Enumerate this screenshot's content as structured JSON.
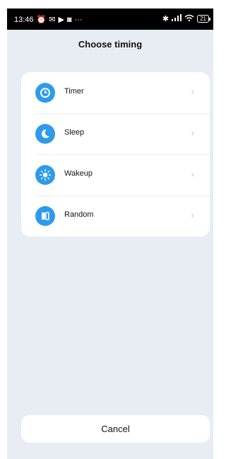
{
  "status_bar": {
    "time": "13:46",
    "battery": "21",
    "left_icons": [
      "alarm-off-icon",
      "message-icon",
      "play-icon",
      "shield-icon",
      "more-icon"
    ],
    "right_icons": [
      "bluetooth-icon",
      "signal-icon",
      "wifi-icon",
      "battery-icon"
    ]
  },
  "header": {
    "title": "Choose timing"
  },
  "timing_options": [
    {
      "label": "Timer",
      "icon": "clock-icon"
    },
    {
      "label": "Sleep",
      "icon": "moon-icon"
    },
    {
      "label": "Wakeup",
      "icon": "sun-icon"
    },
    {
      "label": "Random",
      "icon": "random-icon"
    }
  ],
  "footer": {
    "cancel_label": "Cancel"
  },
  "colors": {
    "accent": "#2f9aeb",
    "background": "#e8edf4",
    "card": "#ffffff",
    "chevron": "#c6c6c6"
  }
}
